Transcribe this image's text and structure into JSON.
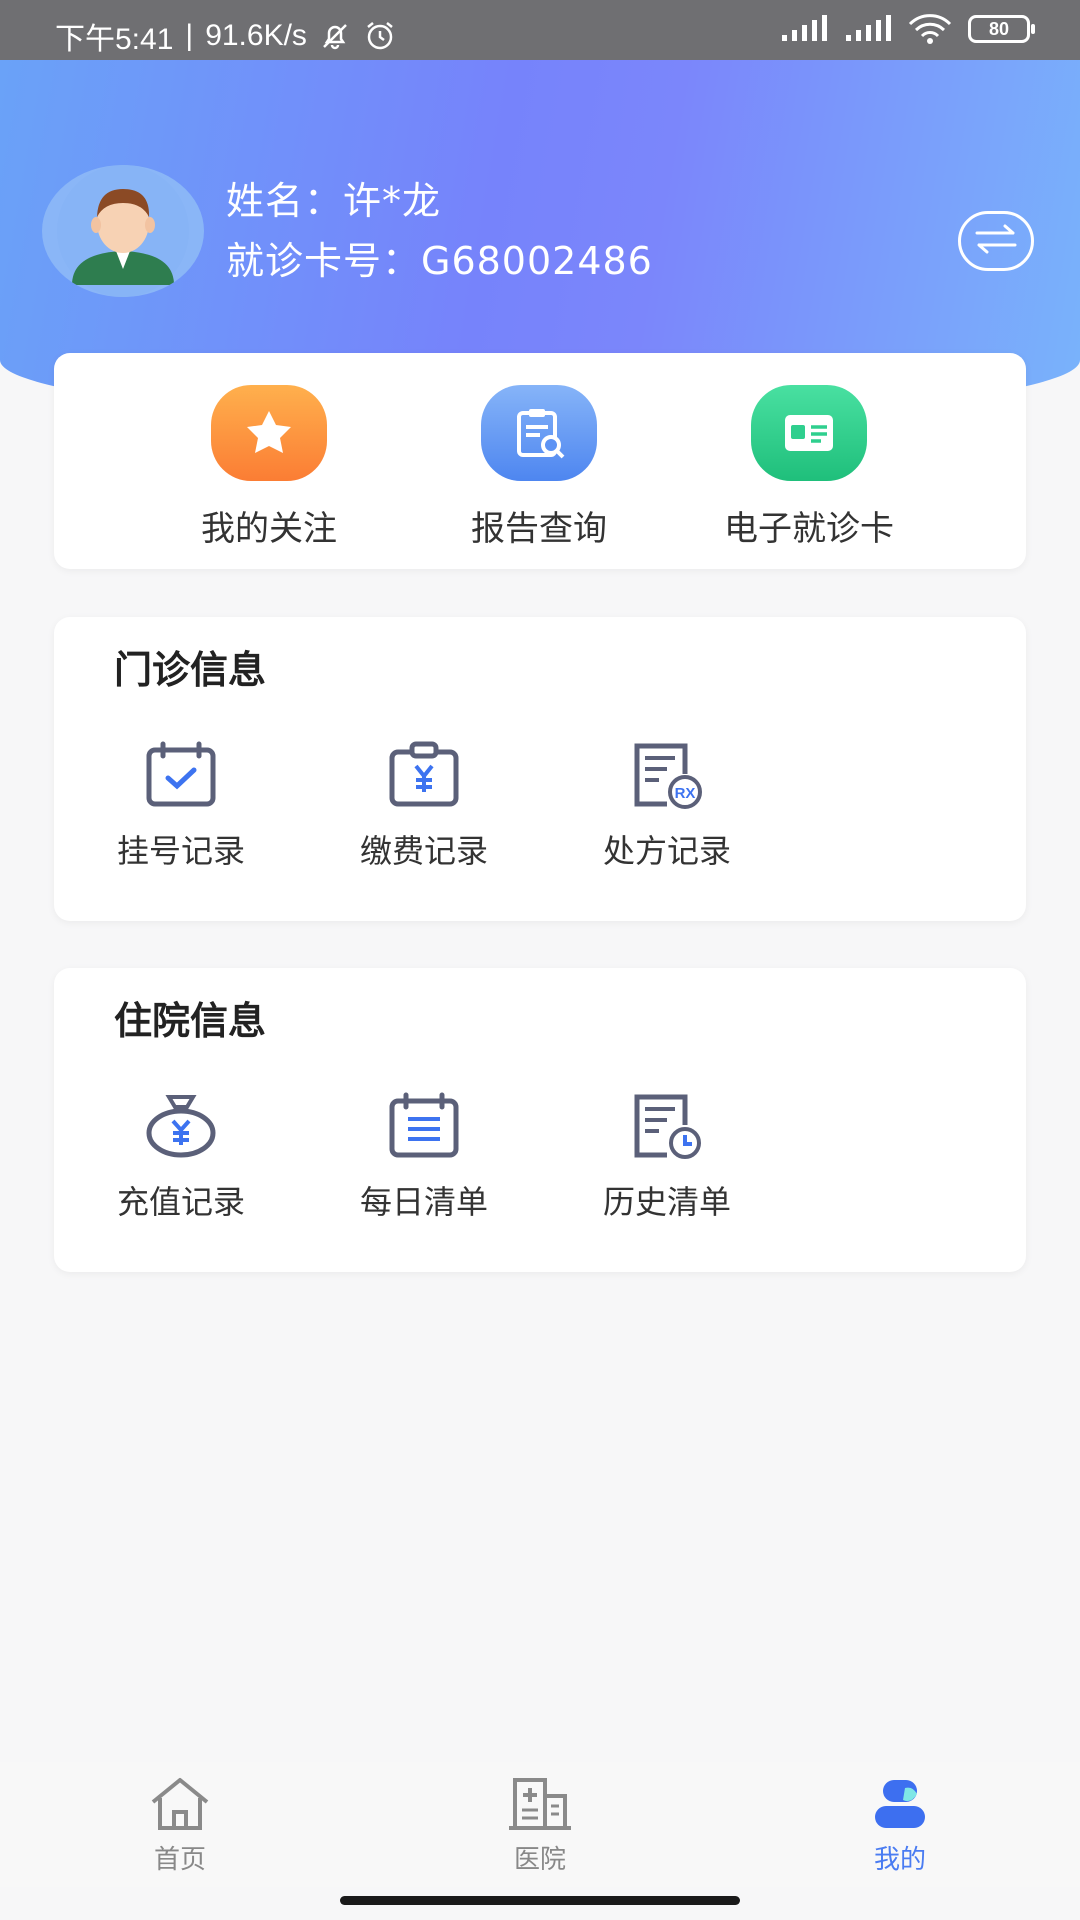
{
  "status_bar": {
    "time": "下午5:41",
    "speed": "91.6K/s",
    "battery": "80",
    "icons": [
      "mute-bell-icon",
      "alarm-icon",
      "signal-icon",
      "signal-icon",
      "wifi-icon",
      "battery-icon"
    ]
  },
  "user": {
    "name_line": "姓名：许*龙",
    "card_line": "就诊卡号：G68002486",
    "switch_icon": "switch-arrows-icon"
  },
  "quick_actions": [
    {
      "label": "我的关注",
      "icon": "star-icon",
      "color": "#fb8e3a"
    },
    {
      "label": "报告查询",
      "icon": "report-search-icon",
      "color": "#5d93f4"
    },
    {
      "label": "电子就诊卡",
      "icon": "id-card-icon",
      "color": "#2fcf8e"
    }
  ],
  "outpatient": {
    "title": "门诊信息",
    "items": [
      {
        "label": "挂号记录",
        "icon": "calendar-check-icon"
      },
      {
        "label": "缴费记录",
        "icon": "payment-clipboard-icon"
      },
      {
        "label": "处方记录",
        "icon": "prescription-icon"
      }
    ]
  },
  "inpatient": {
    "title": "住院信息",
    "items": [
      {
        "label": "充值记录",
        "icon": "money-bag-icon"
      },
      {
        "label": "每日清单",
        "icon": "daily-list-icon"
      },
      {
        "label": "历史清单",
        "icon": "history-list-icon"
      }
    ]
  },
  "tabbar": {
    "tabs": [
      {
        "label": "首页",
        "icon": "home-icon"
      },
      {
        "label": "医院",
        "icon": "hospital-icon"
      },
      {
        "label": "我的",
        "icon": "profile-icon"
      }
    ],
    "active": "我的"
  },
  "colors": {
    "accent": "#4a7cf2",
    "header_start": "#6aa2f8",
    "header_mid": "#7683fb",
    "header_end": "#79b3fb"
  }
}
